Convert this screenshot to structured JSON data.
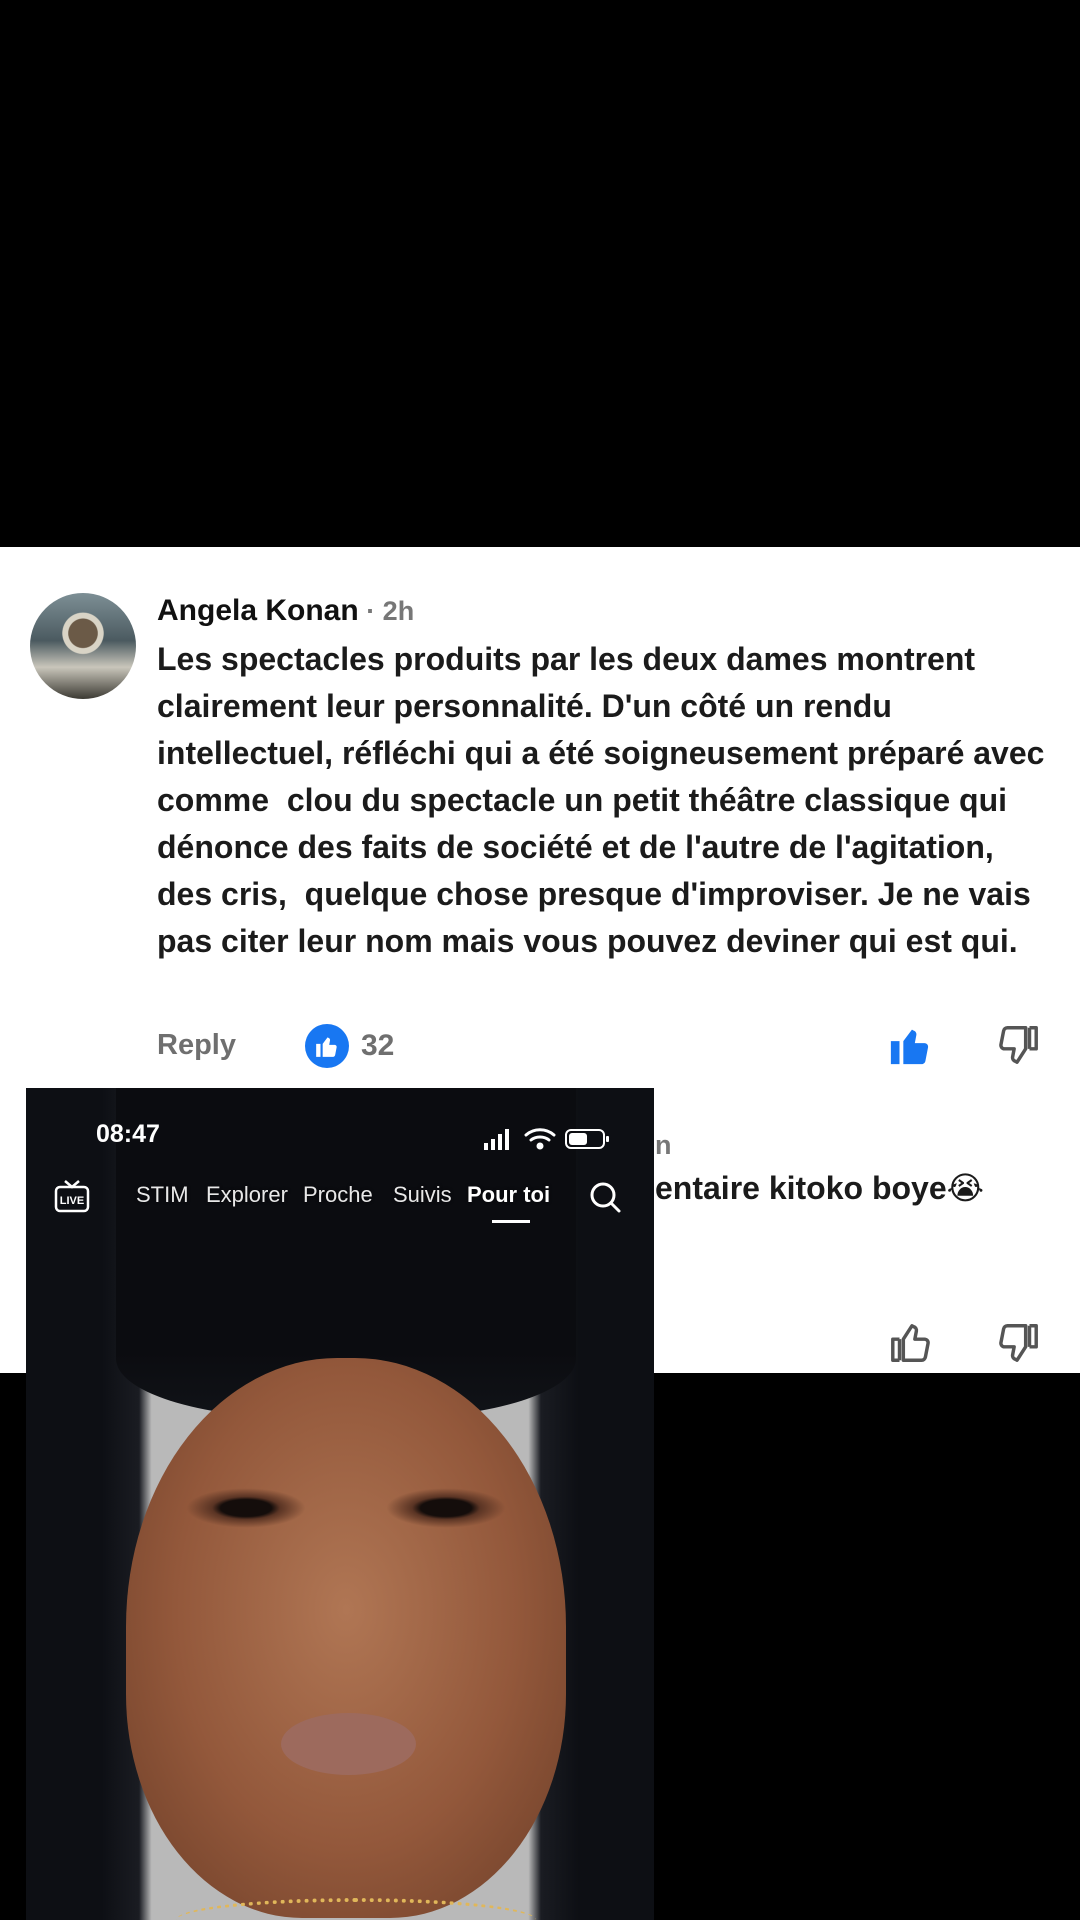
{
  "comment1": {
    "author": "Angela Konan",
    "time": " · 2h",
    "text": "Les spectacles produits par les deux dames montrent clairement leur personnalité. D'un côté un rendu intellectuel, réfléchi qui a été soigneusement préparé avec comme  clou du spectacle un petit théâtre classique qui dénonce des faits de société et de l'autre de l'agitation, des cris,  quelque chose presque d'improviser. Je ne vais pas citer leur nom mais vous pouvez deviner qui est qui.",
    "reply_label": "Reply",
    "like_count": "32"
  },
  "comment2": {
    "author_fragment": "n",
    "text_fragment": "entaire kitoko boye😭"
  },
  "overlay": {
    "status_time": "08:47",
    "live_label": "LIVE",
    "tabs": [
      "STIM",
      "Explorer",
      "Proche",
      "Suivis",
      "Pour toi"
    ],
    "active_tab": "Pour toi"
  },
  "colors": {
    "like_blue": "#1877f2",
    "text_dark": "#1b1b1b",
    "text_muted": "#6f6f6f"
  }
}
